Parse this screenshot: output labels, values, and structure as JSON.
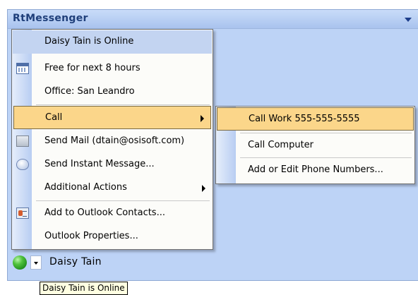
{
  "panel": {
    "title": "RtMessenger"
  },
  "menu": {
    "items": [
      {
        "label": "Daisy Tain is Online"
      },
      {
        "label": "Free for next 8 hours",
        "icon": "calendar-icon"
      },
      {
        "label": "Office: San Leandro"
      },
      {
        "label": "Call",
        "submenu": true
      },
      {
        "label": "Send Mail (dtain@osisoft.com)",
        "icon": "mail-icon"
      },
      {
        "label": "Send Instant Message...",
        "icon": "instant-message-icon"
      },
      {
        "label": "Additional Actions",
        "submenu": true
      },
      {
        "label": "Add to Outlook Contacts...",
        "icon": "contact-card-icon"
      },
      {
        "label": "Outlook Properties..."
      }
    ]
  },
  "submenu": {
    "items": [
      {
        "label": "Call Work 555-555-5555"
      },
      {
        "label": "Call Computer"
      },
      {
        "label": "Add or Edit Phone Numbers..."
      }
    ]
  },
  "presence": {
    "name": "Daisy Tain",
    "status_color": "#2e9e25",
    "status_icon": "online-status-icon"
  },
  "tooltip": {
    "text": "Daisy Tain is Online"
  },
  "colors": {
    "panel_bg": "#bdd3f6",
    "highlight": "#fbd68a",
    "header_item": "#c3d4f1"
  }
}
